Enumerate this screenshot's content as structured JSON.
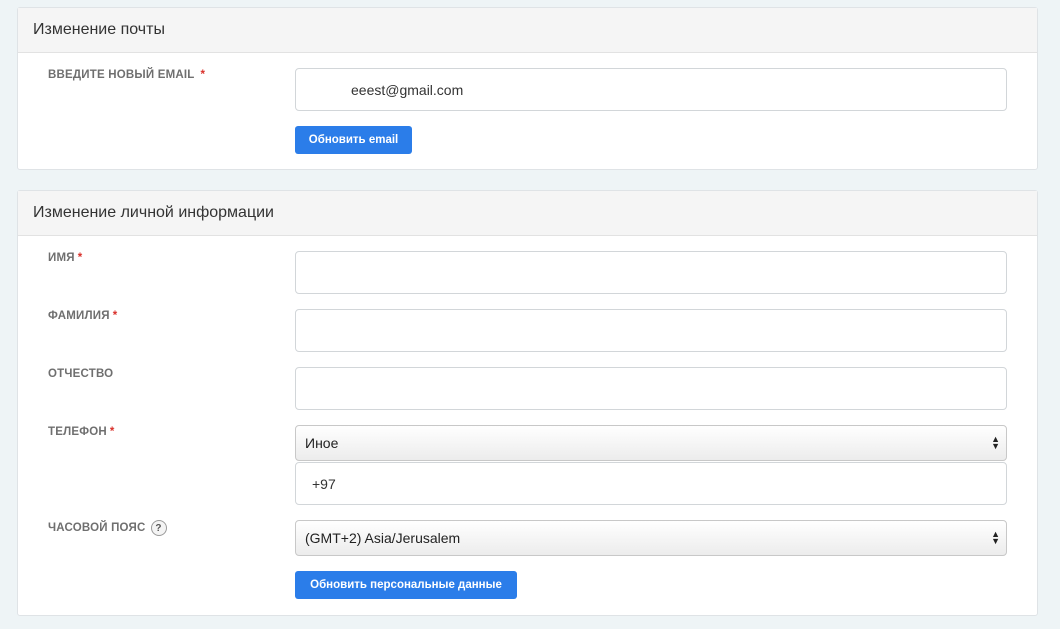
{
  "email_panel": {
    "title": "Изменение почты",
    "email_label": "ВВЕДИТЕ НОВЫЙ EMAIL",
    "required_mark": "*",
    "email_value": "eeest@gmail.com",
    "submit_label": "Обновить email"
  },
  "info_panel": {
    "title": "Изменение личной информации",
    "required_mark": "*",
    "first_name_label": "ИМЯ",
    "first_name_value": "",
    "last_name_label": "ФАМИЛИЯ",
    "last_name_value": "",
    "middle_name_label": "ОТЧЕСТВО",
    "middle_name_value": "",
    "phone_label": "ТЕЛЕФОН",
    "phone_country_selected": "Иное",
    "phone_value": "+97",
    "timezone_label": "ЧАСОВОЙ ПОЯС",
    "timezone_help": "?",
    "timezone_selected": "(GMT+2) Asia/Jerusalem",
    "submit_label": "Обновить персональные данные"
  },
  "colors": {
    "button": "#2b7de9",
    "required": "#d9312b",
    "background": "#eef4f6"
  },
  "icons": {
    "select_arrow": "updown-arrows-icon",
    "help": "question-circle-icon"
  }
}
